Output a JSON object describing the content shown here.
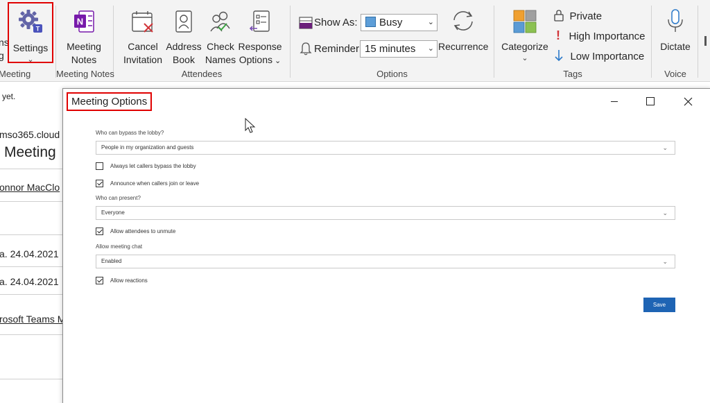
{
  "ribbon": {
    "truncated_left": "ns\ng",
    "settings": {
      "label": "Settings"
    },
    "meeting_notes": {
      "line1": "Meeting",
      "line2": "Notes"
    },
    "cancel_invitation": {
      "line1": "Cancel",
      "line2": "Invitation"
    },
    "address_book": {
      "line1": "Address",
      "line2": "Book"
    },
    "check_names": {
      "line1": "Check",
      "line2": "Names"
    },
    "response_options": {
      "line1": "Response",
      "line2": "Options"
    },
    "show_as": {
      "label": "Show As:",
      "value": "Busy"
    },
    "reminder": {
      "label": "Reminder:",
      "value": "15 minutes"
    },
    "recurrence": {
      "label": "Recurrence"
    },
    "categorize": {
      "label": "Categorize"
    },
    "tags": {
      "private": "Private",
      "high_importance": "High Importance",
      "low_importance": "Low Importance"
    },
    "dictate": {
      "label": "Dictate"
    },
    "groups": {
      "meeting": "Meeting",
      "meeting_notes": "Meeting Notes",
      "attendees": "Attendees",
      "options": "Options",
      "tags": "Tags",
      "voice": "Voice"
    }
  },
  "background": {
    "line1": "yet.",
    "line2": "mso365.cloud",
    "line3": "Meeting",
    "line4": "onnor MacClo",
    "line5": "a. 24.04.2021",
    "line6": "a. 24.04.2021",
    "line7": "rosoft Teams M"
  },
  "dialog": {
    "title": "Meeting Options",
    "bypass_label": "Who can bypass the lobby?",
    "bypass_value": "People in my organization and guests",
    "always_callers": "Always let callers bypass the lobby",
    "announce": "Announce when callers join or leave",
    "present_label": "Who can present?",
    "present_value": "Everyone",
    "allow_unmute": "Allow attendees to unmute",
    "chat_label": "Allow meeting chat",
    "chat_value": "Enabled",
    "allow_reactions": "Allow reactions",
    "save": "Save"
  },
  "colors": {
    "accent_blue": "#1e64b4",
    "highlight_red": "#e00000",
    "busy": "#5d9ed8"
  }
}
